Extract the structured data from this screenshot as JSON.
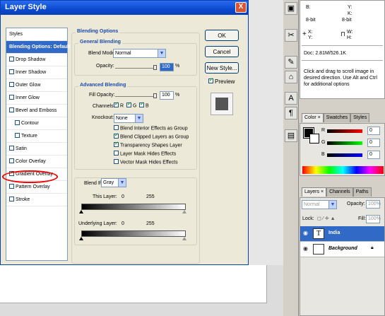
{
  "dialog": {
    "title": "Layer Style",
    "close_glyph": "X",
    "styles_header": "Styles",
    "style_items": [
      {
        "label": "Blending Options: Default",
        "checked": false,
        "has_checkbox": false,
        "selected": true
      },
      {
        "label": "Drop Shadow",
        "checked": false,
        "has_checkbox": true
      },
      {
        "label": "Inner Shadow",
        "checked": false,
        "has_checkbox": true
      },
      {
        "label": "Outer Glow",
        "checked": false,
        "has_checkbox": true
      },
      {
        "label": "Inner Glow",
        "checked": false,
        "has_checkbox": true
      },
      {
        "label": "Bevel and Emboss",
        "checked": false,
        "has_checkbox": true
      },
      {
        "label": "Contour",
        "checked": false,
        "has_checkbox": true,
        "indent": true
      },
      {
        "label": "Texture",
        "checked": false,
        "has_checkbox": true,
        "indent": true
      },
      {
        "label": "Satin",
        "checked": false,
        "has_checkbox": true
      },
      {
        "label": "Color Overlay",
        "checked": false,
        "has_checkbox": true
      },
      {
        "label": "Gradient Overlay",
        "checked": false,
        "has_checkbox": true,
        "highlighted": true
      },
      {
        "label": "Pattern Overlay",
        "checked": false,
        "has_checkbox": true
      },
      {
        "label": "Stroke",
        "checked": false,
        "has_checkbox": true
      }
    ],
    "blending_options_title": "Blending Options",
    "general_blending_title": "General Blending",
    "blend_mode_label": "Blend Mode:",
    "blend_mode_value": "Normal",
    "opacity_label": "Opacity:",
    "opacity_value": "100",
    "percent": "%",
    "advanced_blending_title": "Advanced Blending",
    "fill_opacity_label": "Fill Opacity:",
    "fill_opacity_value": "100",
    "channels_label": "Channels:",
    "channel_r": "R",
    "channel_g": "G",
    "channel_b": "B",
    "knockout_label": "Knockout:",
    "knockout_value": "None",
    "blend_checks": [
      {
        "label": "Blend Interior Effects as Group",
        "checked": false
      },
      {
        "label": "Blend Clipped Layers as Group",
        "checked": true
      },
      {
        "label": "Transparency Shapes Layer",
        "checked": true
      },
      {
        "label": "Layer Mask Hides Effects",
        "checked": false
      },
      {
        "label": "Vector Mask Hides Effects",
        "checked": false
      }
    ],
    "blend_if_label": "Blend If:",
    "blend_if_value": "Gray",
    "this_layer_label": "This Layer:",
    "this_layer_min": "0",
    "this_layer_max": "255",
    "underlying_layer_label": "Underlying Layer:",
    "underlying_min": "0",
    "underlying_max": "255",
    "ok_label": "OK",
    "cancel_label": "Cancel",
    "new_style_label": "New Style...",
    "preview_label": "Preview",
    "preview_checked": true
  },
  "info_panel": {
    "b_label": "B:",
    "y_label": "Y:",
    "k_label": "K:",
    "bit_left": "8-bit",
    "bit_right": "8-bit",
    "x_label": "X:",
    "yy_label": "Y:",
    "w_label": "W:",
    "h_label": "H:",
    "doc_info": "Doc: 2.81M/526.1K",
    "help_text": "Click and drag to scroll image in desired direction. Use Alt and Ctrl for additional options"
  },
  "color_panel": {
    "tabs": [
      "Color",
      "Swatches",
      "Styles"
    ],
    "r_label": "R",
    "g_label": "G",
    "b_label": "B",
    "r_value": "0",
    "g_value": "0",
    "b_value": "0"
  },
  "layers_panel": {
    "tabs": [
      "Layers",
      "Channels",
      "Paths"
    ],
    "blend_mode": "Normal",
    "opacity_label": "Opacity:",
    "opacity_value": "100%",
    "lock_label": "Lock:",
    "fill_label": "Fill:",
    "fill_value": "100%",
    "layers": [
      {
        "name": "India",
        "thumb": "T",
        "selected": true
      },
      {
        "name": "Background",
        "thumb": "",
        "selected": false,
        "locked": true
      }
    ]
  },
  "colors": {
    "accent": "#3169c6",
    "titlebar": "#0a4ad0",
    "highlight_oval": "#e00000"
  }
}
